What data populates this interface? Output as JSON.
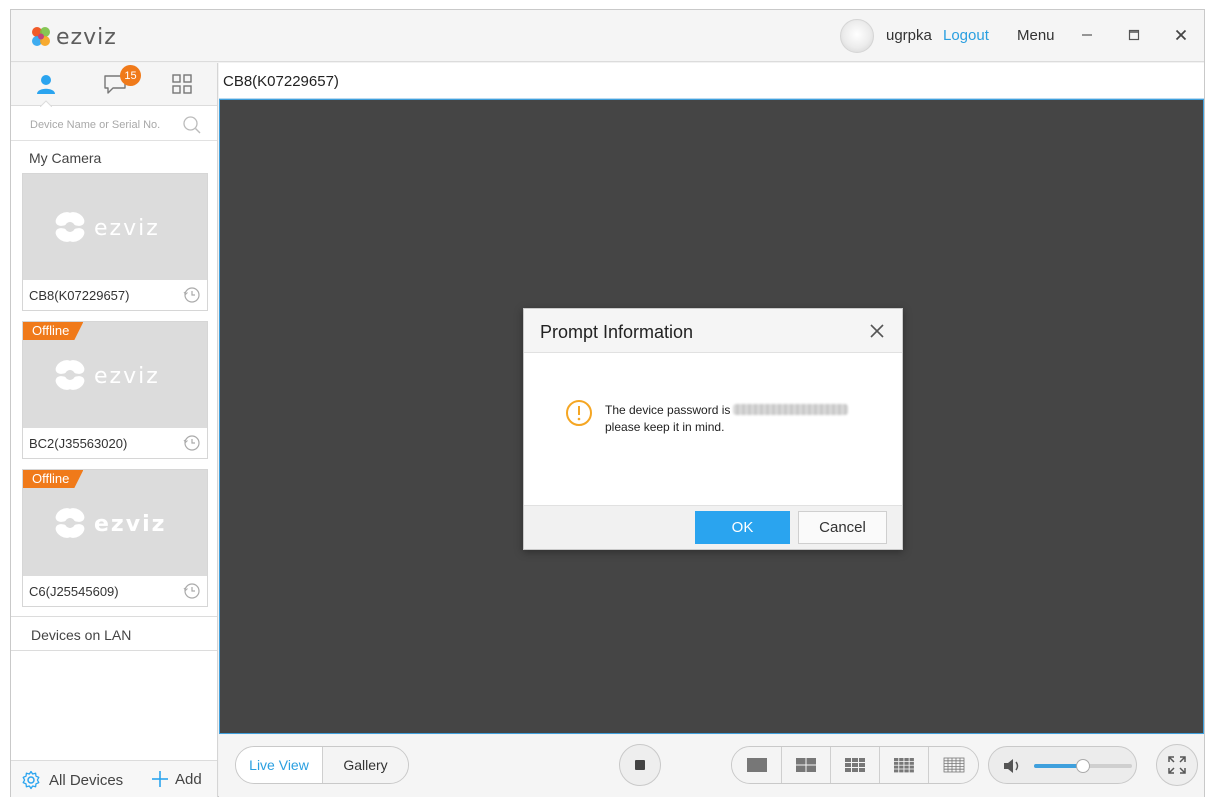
{
  "app": {
    "logo_text": "ezviz",
    "username": "ugrpka",
    "logout_label": "Logout",
    "menu_label": "Menu"
  },
  "sidebar": {
    "message_badge": "15",
    "search_placeholder": "Device Name or Serial No.",
    "my_camera_label": "My Camera",
    "cameras": [
      {
        "name": "CB8(K07229657)",
        "status": ""
      },
      {
        "name": "BC2(J35563020)",
        "status": "Offline"
      },
      {
        "name": "C6(J25545609)",
        "status": "Offline"
      }
    ],
    "lan_label": "Devices on LAN",
    "footer": {
      "all_devices_label": "All Devices",
      "add_label": "Add"
    }
  },
  "main": {
    "active_tab": "CB8(K07229657)"
  },
  "dialog": {
    "title": "Prompt Information",
    "message_line1": "The device password is",
    "message_line2": "please keep it in mind.",
    "ok_label": "OK",
    "cancel_label": "Cancel"
  },
  "toolbar": {
    "live_view_label": "Live View",
    "gallery_label": "Gallery",
    "volume_level": 0.5
  },
  "colors": {
    "accent": "#2aa4ef",
    "badge": "#f07a1a",
    "video_bg": "#454545"
  }
}
